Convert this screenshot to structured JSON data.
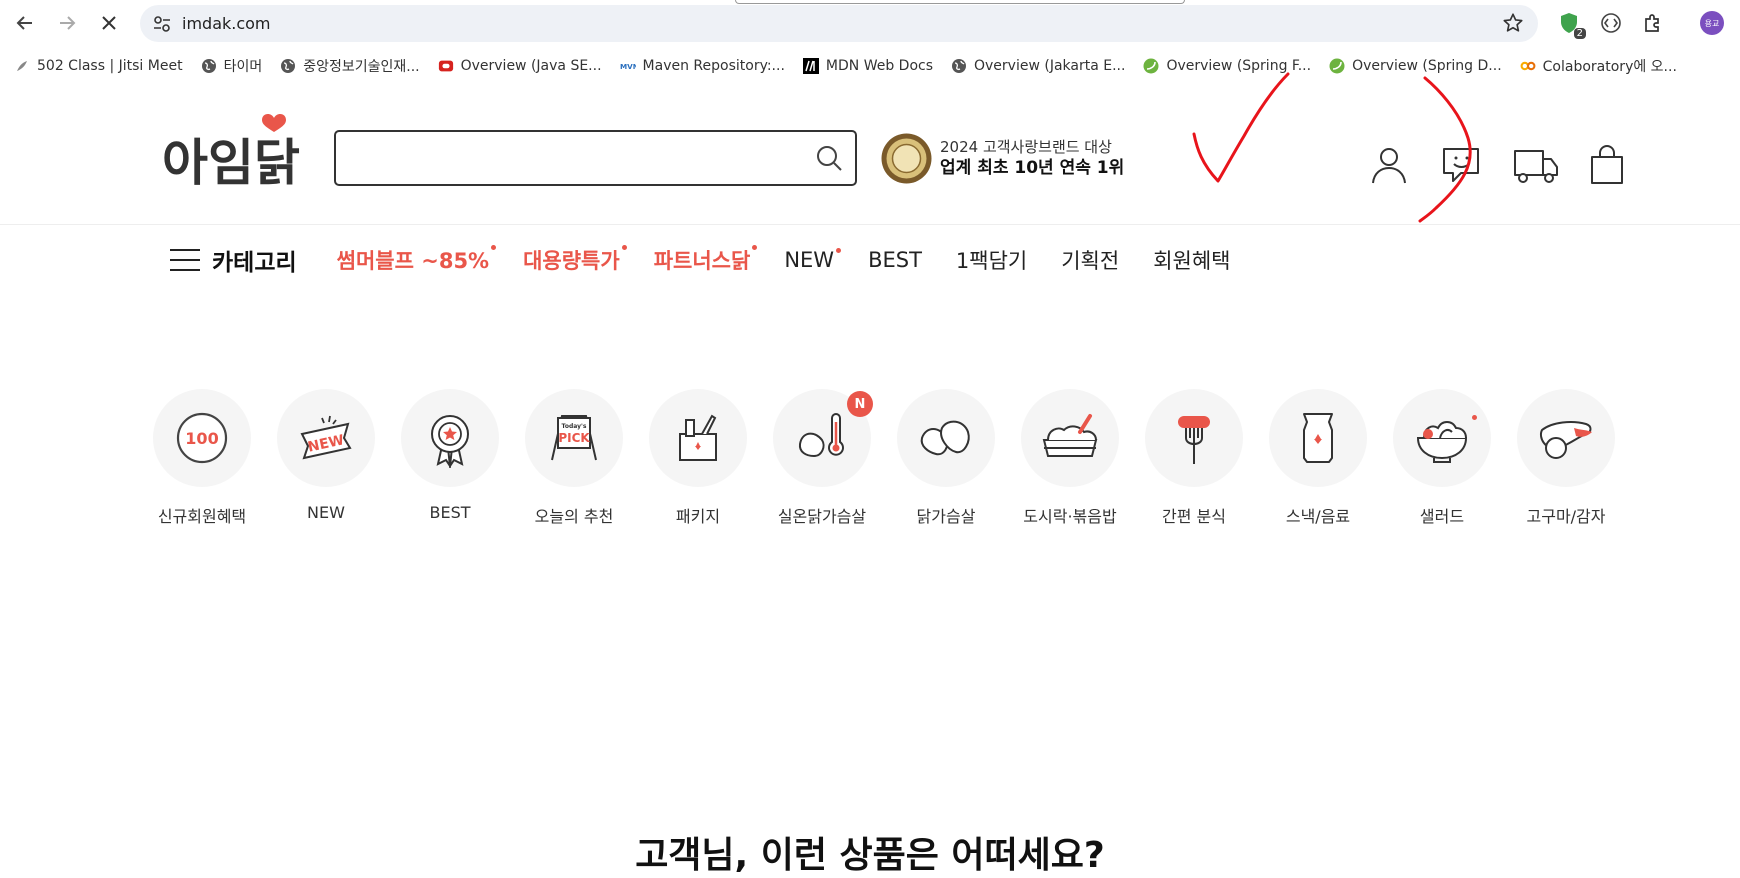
{
  "browser": {
    "url": "imdak.com",
    "extension_badge": "2",
    "profile_initial": "용교",
    "bookmarks": [
      {
        "label": "502 Class | Jitsi Meet",
        "icon": "jitsi-icon"
      },
      {
        "label": "타이머",
        "icon": "globe-icon"
      },
      {
        "label": "중앙정보기술인재...",
        "icon": "globe-icon"
      },
      {
        "label": "Overview (Java SE...",
        "icon": "oracle-icon"
      },
      {
        "label": "Maven Repository:...",
        "icon": "maven-icon"
      },
      {
        "label": "MDN Web Docs",
        "icon": "mdn-icon"
      },
      {
        "label": "Overview (Jakarta E...",
        "icon": "globe-icon"
      },
      {
        "label": "Overview (Spring F...",
        "icon": "spring-icon"
      },
      {
        "label": "Overview (Spring D...",
        "icon": "spring-icon"
      },
      {
        "label": "Colaboratory에 오...",
        "icon": "colab-icon"
      }
    ]
  },
  "site": {
    "logo_text": "아임닭",
    "search_placeholder": "",
    "award": {
      "line1": "2024 고객사랑브랜드 대상",
      "line2": "업계 최초 10년 연속 1위"
    },
    "gnb": {
      "category_label": "카테고리",
      "items": [
        {
          "label": "썸머블프 ~85%",
          "hot": true,
          "dot": true
        },
        {
          "label": "대용량특가",
          "hot": true,
          "dot": true
        },
        {
          "label": "파트너스닭",
          "hot": true,
          "dot": true
        },
        {
          "label": "NEW",
          "hot": false,
          "dot": true
        },
        {
          "label": "BEST",
          "hot": false,
          "dot": false
        },
        {
          "label": "1팩담기",
          "hot": false,
          "dot": false
        },
        {
          "label": "기획전",
          "hot": false,
          "dot": false
        },
        {
          "label": "회원혜택",
          "hot": false,
          "dot": false
        }
      ]
    },
    "quick_categories": [
      {
        "label": "신규회원혜택",
        "icon": "hundred-icon"
      },
      {
        "label": "NEW",
        "icon": "new-banner-icon"
      },
      {
        "label": "BEST",
        "icon": "best-medal-icon"
      },
      {
        "label": "오늘의 추천",
        "icon": "todays-pick-icon",
        "icon_text": "Today's PICK"
      },
      {
        "label": "패키지",
        "icon": "package-icon"
      },
      {
        "label": "실온닭가슴살",
        "icon": "thermometer-chicken-icon",
        "badge": "N"
      },
      {
        "label": "닭가슴살",
        "icon": "chicken-breast-icon"
      },
      {
        "label": "도시락·볶음밥",
        "icon": "lunchbox-icon"
      },
      {
        "label": "간편 분식",
        "icon": "sausage-fork-icon"
      },
      {
        "label": "스낵/음료",
        "icon": "snack-bag-icon"
      },
      {
        "label": "샐러드",
        "icon": "salad-bowl-icon"
      },
      {
        "label": "고구마/감자",
        "icon": "sweet-potato-icon"
      }
    ],
    "recommend_title": "고객님, 이런 상품은 어떠세요?"
  },
  "colors": {
    "accent": "#e9564a",
    "annotation": "#e8141b"
  }
}
